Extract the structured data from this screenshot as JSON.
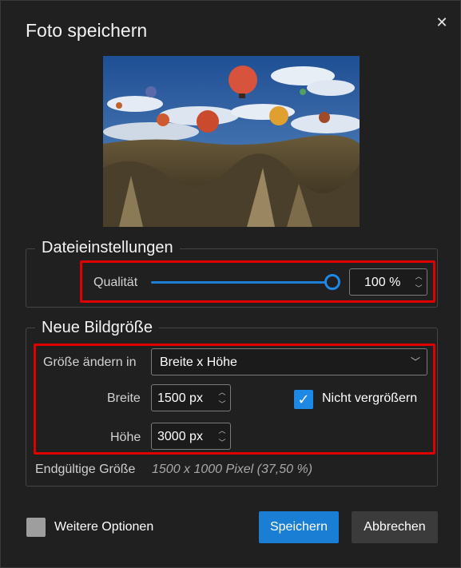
{
  "dialog": {
    "title": "Foto speichern",
    "close_icon": "close-icon"
  },
  "file_settings": {
    "legend": "Dateieinstellungen",
    "quality_label": "Qualität",
    "quality_slider_fraction": 1.0,
    "quality_value": "100 %"
  },
  "resize": {
    "legend": "Neue Bildgröße",
    "resize_in_label": "Größe ändern in",
    "resize_in_value": "Breite x Höhe",
    "width_label": "Breite",
    "width_value": "1500 px",
    "height_label": "Höhe",
    "height_value": "3000 px",
    "no_enlarge_label": "Nicht vergrößern",
    "no_enlarge_checked": true,
    "final_size_label": "Endgültige Größe",
    "final_size_value": "1500 x 1000 Pixel (37,50 %)"
  },
  "footer": {
    "more_options_label": "Weitere Optionen",
    "more_options_checked": false,
    "save_label": "Speichern",
    "cancel_label": "Abbrechen"
  },
  "colors": {
    "accent": "#1e88e5",
    "highlight": "#e00000",
    "background": "#202020"
  }
}
